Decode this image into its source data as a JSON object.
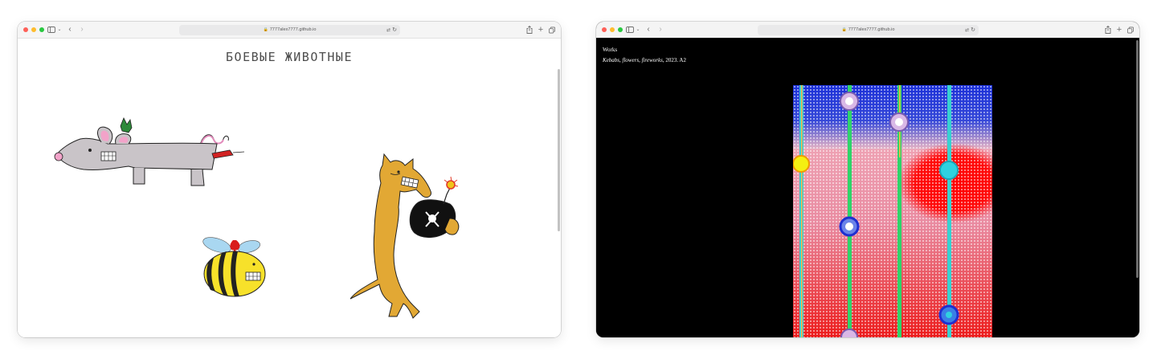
{
  "left_window": {
    "url": "7777alex7777.github.io",
    "heading": "БОЕВЫЕ ЖИВОТНЫЕ",
    "illustrations": [
      "mouse",
      "bee",
      "dog-with-bomb"
    ]
  },
  "right_window": {
    "url": "7777alex7777.github.io",
    "nav_link": "Works",
    "caption": {
      "title": "Kebabs, flowers, fireworks",
      "details": ", 2023. A2"
    }
  },
  "icons": {
    "sidebar": "sidebar-icon",
    "back": "chevron-left-icon",
    "forward": "chevron-right-icon",
    "lock": "lock-icon",
    "translate": "translate-icon",
    "reload": "reload-icon",
    "share": "share-icon",
    "new_tab": "plus-icon",
    "tabs": "tab-overview-icon"
  },
  "colors": {
    "close": "#fe5f57",
    "minimize": "#febc2e",
    "zoom": "#28c840",
    "right_page_bg": "#000000"
  }
}
